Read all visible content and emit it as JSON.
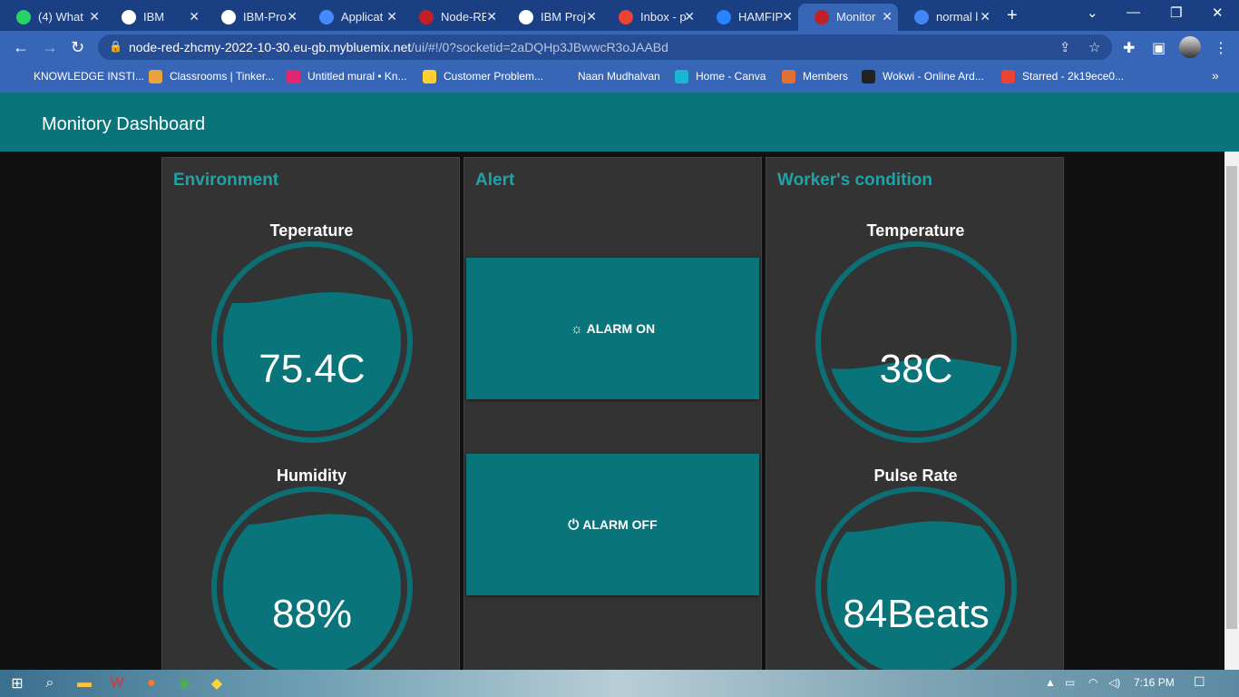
{
  "browser": {
    "tabs": [
      {
        "label": "(4) What",
        "icon": "whatsapp-icon",
        "color": "#25d366"
      },
      {
        "label": "IBM",
        "icon": "globe-icon",
        "color": "#ffffff"
      },
      {
        "label": "IBM-Pro",
        "icon": "github-icon",
        "color": "#ffffff"
      },
      {
        "label": "Applicat",
        "icon": "ibm-cloud-icon",
        "color": "#4589ff"
      },
      {
        "label": "Node-RE",
        "icon": "node-red-icon",
        "color": "#c21f27"
      },
      {
        "label": "IBM Proj",
        "icon": "wix-icon",
        "color": "#ffffff"
      },
      {
        "label": "Inbox - p",
        "icon": "gmail-icon",
        "color": "#ea4335"
      },
      {
        "label": "HAMFIP",
        "icon": "jira-icon",
        "color": "#2684ff"
      },
      {
        "label": "Monitor",
        "icon": "node-red-icon",
        "color": "#c21f27",
        "active": true
      },
      {
        "label": "normal l",
        "icon": "google-icon",
        "color": "#4285f4"
      }
    ],
    "url_host": "node-red-zhcmy-2022-10-30.eu-gb.mybluemix.net",
    "url_path": "/ui/#!/0?socketid=2aDQHp3JBwwcR3oJAABd",
    "bookmarks": [
      {
        "label": "KNOWLEDGE INSTI...",
        "icon": "globe-icon",
        "color": "#3766b6"
      },
      {
        "label": "Classrooms | Tinker...",
        "icon": "tinkercad-icon",
        "color": "#e8a33c"
      },
      {
        "label": "Untitled mural • Kn...",
        "icon": "mural-icon",
        "color": "#e0266f"
      },
      {
        "label": "Customer Problem...",
        "icon": "miro-icon",
        "color": "#ffd02f"
      },
      {
        "label": "Naan Mudhalvan",
        "icon": "globe-icon",
        "color": "#3766b6"
      },
      {
        "label": "Home - Canva",
        "icon": "canva-icon",
        "color": "#1ab6d5"
      },
      {
        "label": "Members",
        "icon": "members-icon",
        "color": "#e46f34"
      },
      {
        "label": "Wokwi - Online Ard...",
        "icon": "wix-icon",
        "color": "#222222"
      },
      {
        "label": "Starred - 2k19ece0...",
        "icon": "gmail-icon",
        "color": "#ea4335"
      }
    ]
  },
  "dashboard": {
    "title": "Monitory Dashboard",
    "accent": "#097479",
    "groups": {
      "environment": {
        "title": "Environment",
        "gauges": [
          {
            "label": "Teperature",
            "value_text": "75.4C",
            "level": 0.75
          },
          {
            "label": "Humidity",
            "value_text": "88%",
            "level": 0.88
          }
        ]
      },
      "alert": {
        "title": "Alert",
        "buttons": [
          {
            "label": "ALARM ON",
            "icon": "sun-icon"
          },
          {
            "label": "ALARM OFF",
            "icon": "power-icon"
          }
        ]
      },
      "worker": {
        "title": "Worker's condition",
        "gauges": [
          {
            "label": "Temperature",
            "value_text": "38C",
            "level": 0.38
          },
          {
            "label": "Pulse Rate",
            "value_text": "84Beats",
            "level": 0.84
          }
        ]
      }
    }
  },
  "taskbar": {
    "time": "7:16 PM"
  }
}
